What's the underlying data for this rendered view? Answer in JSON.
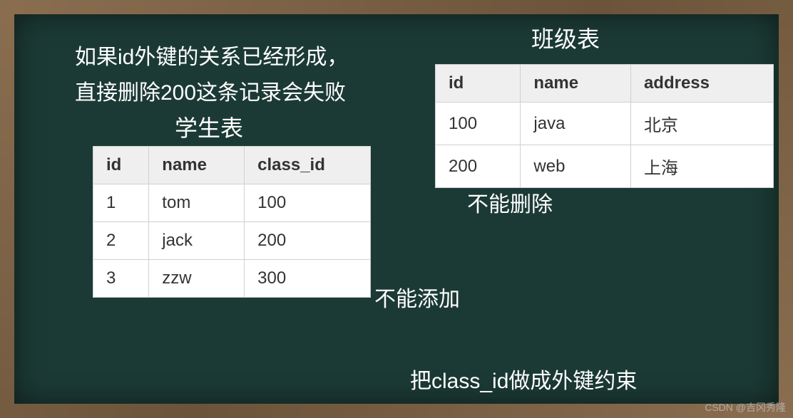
{
  "notes": {
    "line1": "如果id外键的关系已经形成，",
    "line2": "直接删除200这条记录会失败"
  },
  "studentTable": {
    "title": "学生表",
    "headers": {
      "id": "id",
      "name": "name",
      "class_id": "class_id"
    },
    "rows": [
      {
        "id": "1",
        "name": "tom",
        "class_id": "100"
      },
      {
        "id": "2",
        "name": "jack",
        "class_id": "200"
      },
      {
        "id": "3",
        "name": "zzw",
        "class_id": "300"
      }
    ]
  },
  "classTable": {
    "title": "班级表",
    "headers": {
      "id": "id",
      "name": "name",
      "address": "address"
    },
    "rows": [
      {
        "id": "100",
        "name": "java",
        "address": "北京"
      },
      {
        "id": "200",
        "name": "web",
        "address": "上海"
      }
    ]
  },
  "annotations": {
    "cannotAdd": "不能添加",
    "cannotDelete": "不能删除",
    "fkConstraint": "把class_id做成外键约束"
  },
  "watermark": "CSDN @吉冈秀隆"
}
